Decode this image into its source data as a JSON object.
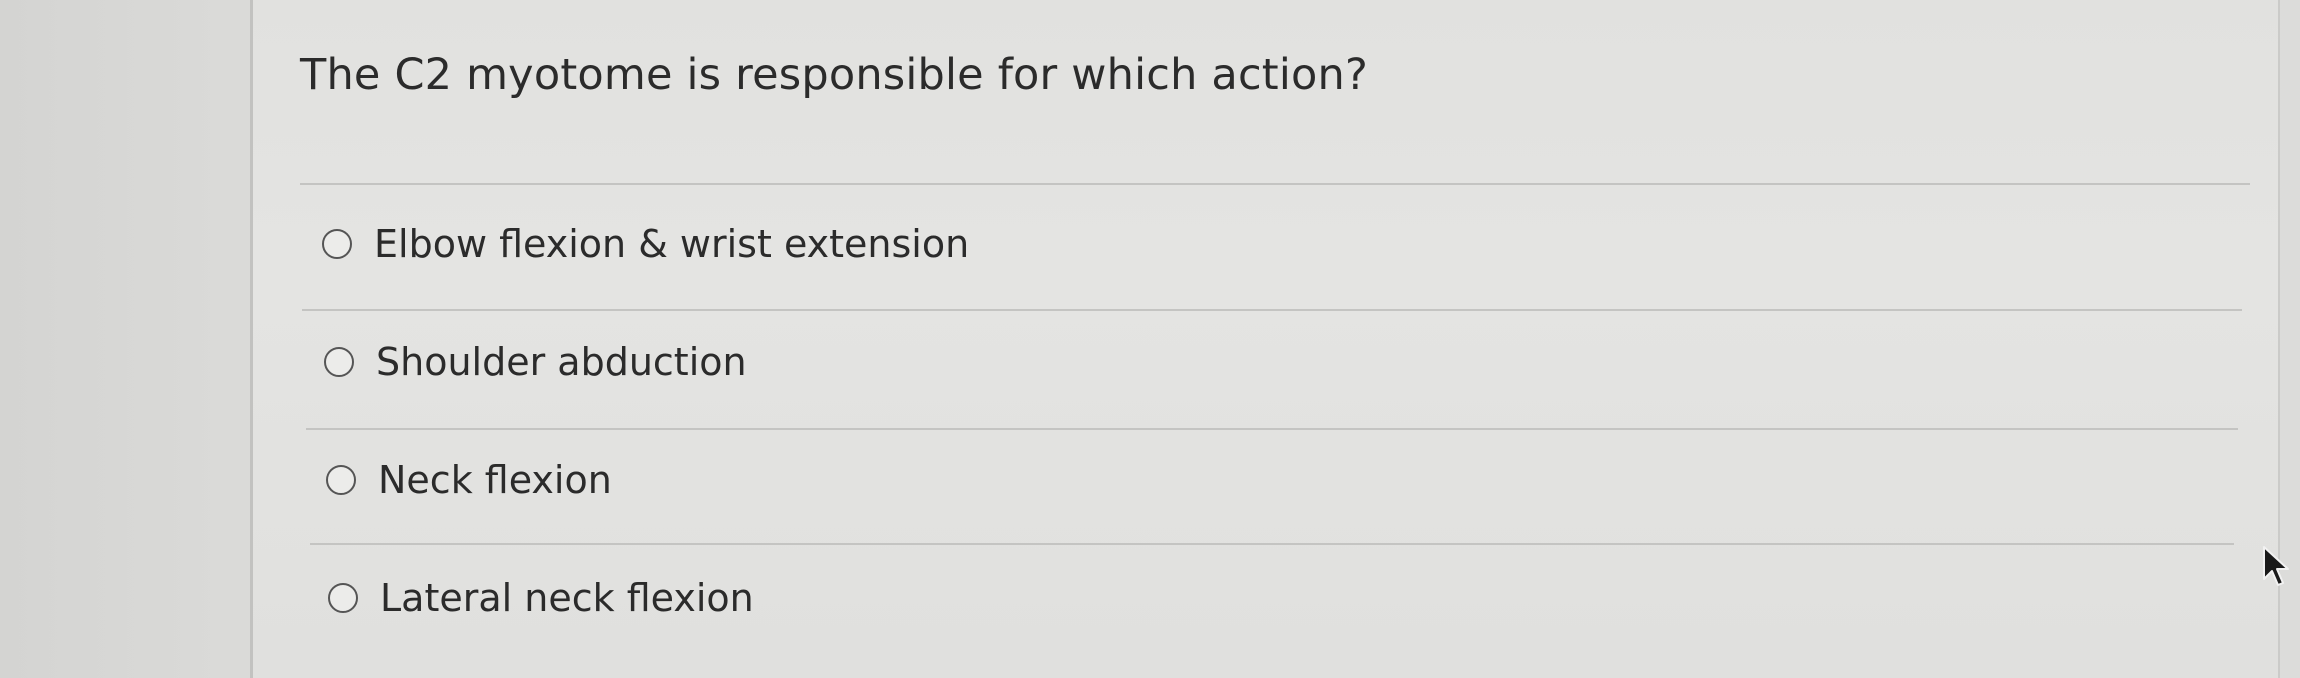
{
  "question": {
    "text": "The C2 myotome is responsible for which action?"
  },
  "options": [
    {
      "label": "Elbow flexion & wrist extension",
      "selected": false
    },
    {
      "label": "Shoulder abduction",
      "selected": false
    },
    {
      "label": "Neck flexion",
      "selected": false
    },
    {
      "label": "Lateral neck flexion",
      "selected": false
    }
  ],
  "icons": {
    "cursor": "mouse-pointer-icon"
  }
}
